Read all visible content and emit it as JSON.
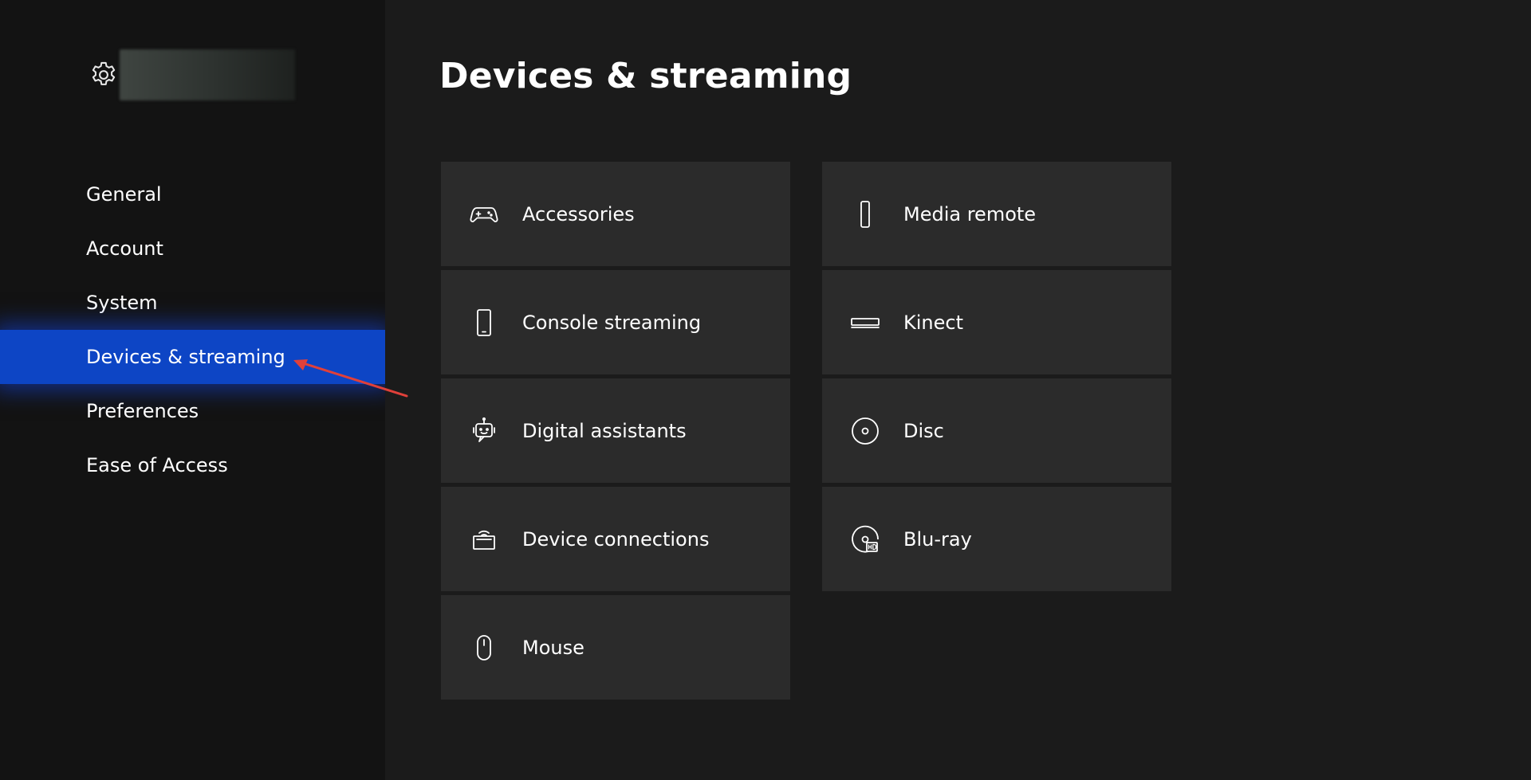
{
  "sidebar": {
    "header_icon": "gear-icon",
    "items": [
      {
        "label": "General",
        "selected": false
      },
      {
        "label": "Account",
        "selected": false
      },
      {
        "label": "System",
        "selected": false
      },
      {
        "label": "Devices & streaming",
        "selected": true
      },
      {
        "label": "Preferences",
        "selected": false
      },
      {
        "label": "Ease of Access",
        "selected": false
      }
    ]
  },
  "main": {
    "title": "Devices & streaming",
    "tiles_left": [
      {
        "label": "Accessories",
        "icon": "controller-icon"
      },
      {
        "label": "Console streaming",
        "icon": "phone-icon"
      },
      {
        "label": "Digital assistants",
        "icon": "assistant-icon"
      },
      {
        "label": "Device connections",
        "icon": "device-connections-icon"
      },
      {
        "label": "Mouse",
        "icon": "mouse-icon"
      }
    ],
    "tiles_right": [
      {
        "label": "Media remote",
        "icon": "remote-icon"
      },
      {
        "label": "Kinect",
        "icon": "kinect-icon"
      },
      {
        "label": "Disc",
        "icon": "disc-icon"
      },
      {
        "label": "Blu-ray",
        "icon": "bluray-icon"
      }
    ]
  },
  "colors": {
    "accent": "#0d45c5",
    "tile_bg": "#2b2b2b",
    "main_bg": "#1b1b1b",
    "sidebar_bg": "#131313",
    "annotation_arrow": "#e0403a"
  }
}
